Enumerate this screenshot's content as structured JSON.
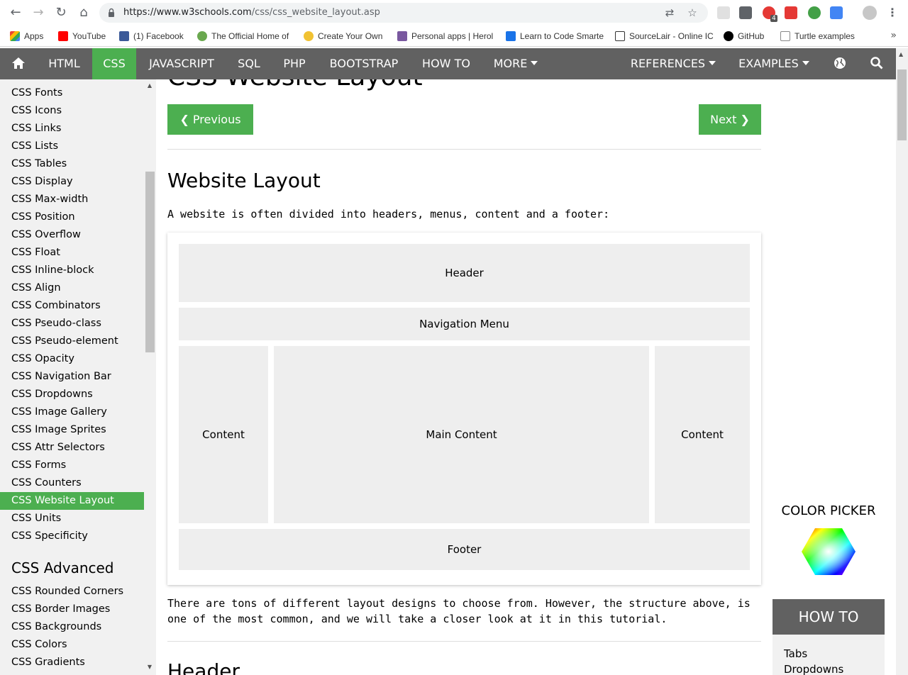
{
  "browser": {
    "url_host": "https://www.w3schools.com",
    "url_path": "/css/css_website_layout.asp",
    "bookmarks": [
      {
        "label": "Apps",
        "icon": "apps-grid-icon",
        "color": "#4285f4"
      },
      {
        "label": "YouTube",
        "icon": "youtube-icon",
        "color": "#ff0000"
      },
      {
        "label": "(1) Facebook",
        "icon": "facebook-icon",
        "color": "#3b5998"
      },
      {
        "label": "The Official Home of",
        "icon": "official-home-icon",
        "color": "#6aa84f"
      },
      {
        "label": "Create Your Own",
        "icon": "create-your-own-icon",
        "color": "#f1c232"
      },
      {
        "label": "Personal apps | Herol",
        "icon": "heroku-icon",
        "color": "#79589f"
      },
      {
        "label": "Learn to Code Smarte",
        "icon": "learn-code-icon",
        "color": "#1a73e8"
      },
      {
        "label": "SourceLair - Online IC",
        "icon": "sourcelair-icon",
        "color": "#333333"
      },
      {
        "label": "GitHub",
        "icon": "github-icon",
        "color": "#000000"
      },
      {
        "label": "Turtle examples",
        "icon": "page-icon",
        "color": "#888888"
      }
    ],
    "more_bookmarks": "»",
    "extension_badge": "4"
  },
  "topnav": {
    "items": [
      "HTML",
      "CSS",
      "JAVASCRIPT",
      "SQL",
      "PHP",
      "BOOTSTRAP",
      "HOW TO",
      "MORE"
    ],
    "right_items": [
      "REFERENCES",
      "EXAMPLES"
    ],
    "active": "CSS",
    "accent_color": "#4CAF50",
    "bar_color": "#616161"
  },
  "sidebar": {
    "items": [
      "CSS Fonts",
      "CSS Icons",
      "CSS Links",
      "CSS Lists",
      "CSS Tables",
      "CSS Display",
      "CSS Max-width",
      "CSS Position",
      "CSS Overflow",
      "CSS Float",
      "CSS Inline-block",
      "CSS Align",
      "CSS Combinators",
      "CSS Pseudo-class",
      "CSS Pseudo-element",
      "CSS Opacity",
      "CSS Navigation Bar",
      "CSS Dropdowns",
      "CSS Image Gallery",
      "CSS Image Sprites",
      "CSS Attr Selectors",
      "CSS Forms",
      "CSS Counters",
      "CSS Website Layout",
      "CSS Units",
      "CSS Specificity"
    ],
    "active": "CSS Website Layout",
    "advanced_heading": "CSS Advanced",
    "advanced_items": [
      "CSS Rounded Corners",
      "CSS Border Images",
      "CSS Backgrounds",
      "CSS Colors",
      "CSS Gradients"
    ]
  },
  "main": {
    "title": "CSS Website Layout",
    "prev_label": "❮ Previous",
    "next_label": "Next ❯",
    "section_title": "Website Layout",
    "intro": "A website is often divided into headers, menus, content and a footer:",
    "demo": {
      "header": "Header",
      "nav": "Navigation Menu",
      "left": "Content",
      "center": "Main Content",
      "right": "Content",
      "footer": "Footer"
    },
    "paragraph": "There are tons of different layout designs to choose from. However, the structure above, is one of the most common, and we will take a closer look at it in this tutorial.",
    "next_heading": "Header"
  },
  "right_column": {
    "color_picker_title": "COLOR PICKER",
    "howto_title": "HOW TO",
    "howto_items": [
      "Tabs",
      "Dropdowns"
    ]
  }
}
